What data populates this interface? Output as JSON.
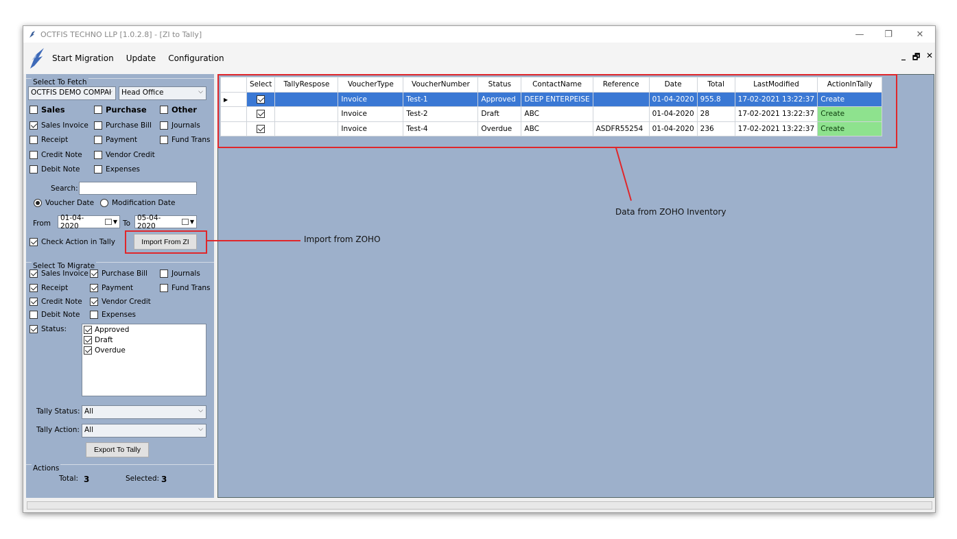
{
  "window": {
    "title": "OCTFIS TECHNO LLP [1.0.2.8] - [ZI to Tally]",
    "min_glyph": "—",
    "restore_glyph": "❐",
    "close_glyph": "✕",
    "mdi_min": "_",
    "mdi_restore": "🗗",
    "mdi_close": "✕"
  },
  "menu": {
    "items": [
      "Start Migration",
      "Update",
      "Configuration"
    ]
  },
  "fetch": {
    "group_title": "Select To Fetch",
    "company": "OCTFIS DEMO COMPAI",
    "branch": "Head Office",
    "sales_label": "Sales",
    "purchase_label": "Purchase",
    "other_label": "Other",
    "checks": [
      {
        "label": "Sales Invoice",
        "checked": true
      },
      {
        "label": "Purchase Bill",
        "checked": false
      },
      {
        "label": "Journals",
        "checked": false
      },
      {
        "label": "Receipt",
        "checked": false
      },
      {
        "label": "Payment",
        "checked": false
      },
      {
        "label": "Fund Trans",
        "checked": false
      },
      {
        "label": "Credit Note",
        "checked": false
      },
      {
        "label": "Vendor Credit",
        "checked": false
      },
      {
        "label": "Debit Note",
        "checked": false
      },
      {
        "label": "Expenses",
        "checked": false
      }
    ],
    "search_label": "Search:",
    "search_value": "",
    "radio_voucher": "Voucher Date",
    "radio_modification": "Modification Date",
    "from_label": "From",
    "from_date": "01-04-2020",
    "to_label": "To",
    "to_date": "05-04-2020",
    "check_action_label": "Check Action in Tally",
    "import_button": "Import From ZI"
  },
  "migrate": {
    "group_title": "Select To Migrate",
    "checks": [
      {
        "label": "Sales Invoice",
        "checked": true
      },
      {
        "label": "Purchase Bill",
        "checked": true
      },
      {
        "label": "Journals",
        "checked": false
      },
      {
        "label": "Receipt",
        "checked": true
      },
      {
        "label": "Payment",
        "checked": true
      },
      {
        "label": "Fund Trans",
        "checked": false
      },
      {
        "label": "Credit Note",
        "checked": true
      },
      {
        "label": "Vendor Credit",
        "checked": true
      },
      {
        "label": "Debit Note",
        "checked": false
      },
      {
        "label": "Expenses",
        "checked": false
      }
    ],
    "status_label": "Status:",
    "status_items": [
      "Approved",
      "Draft",
      "Overdue"
    ],
    "tally_status_label": "Tally Status:",
    "tally_status_value": "All",
    "tally_action_label": "Tally Action:",
    "tally_action_value": "All",
    "export_button": "Export To Tally"
  },
  "actions": {
    "group_title": "Actions",
    "total_label": "Total:",
    "total_value": "3",
    "selected_label": "Selected:",
    "selected_value": "3"
  },
  "grid": {
    "columns": [
      "Select",
      "TallyRespose",
      "VoucherType",
      "VoucherNumber",
      "Status",
      "ContactName",
      "Reference",
      "Date",
      "Total",
      "LastModified",
      "ActionInTally"
    ],
    "rows": [
      [
        "",
        "",
        "Invoice",
        "Test-1",
        "Approved",
        "DEEP ENTERPEISE",
        "",
        "01-04-2020",
        "955.8",
        "17-02-2021 13:22:37",
        "Create"
      ],
      [
        "",
        "",
        "Invoice",
        "Test-2",
        "Draft",
        "ABC",
        "",
        "01-04-2020",
        "28",
        "17-02-2021 13:22:37",
        "Create"
      ],
      [
        "",
        "",
        "Invoice",
        "Test-4",
        "Overdue",
        "ABC",
        "ASDFR55254",
        "01-04-2020",
        "236",
        "17-02-2021 13:22:37",
        "Create"
      ]
    ]
  },
  "annotations": {
    "data_label": "Data from ZOHO Inventory",
    "import_label": "Import from ZOHO"
  },
  "colors": {
    "panel_bg": "#9db0cb",
    "selected_row": "#3a78d4",
    "action_green": "#8ee28e",
    "annotation_red": "#e0262a"
  }
}
